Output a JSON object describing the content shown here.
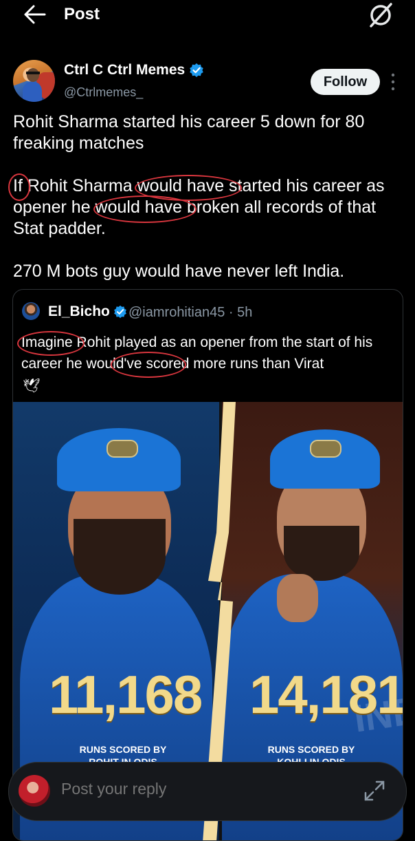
{
  "header": {
    "title": "Post"
  },
  "post": {
    "author_name": "Ctrl C Ctrl Memes",
    "author_handle": "@Ctrlmemes_",
    "follow_label": "Follow",
    "paragraphs": [
      "Rohit Sharma started his career 5 down for 80 freaking matches",
      "If Rohit Sharma would have started his career as opener he would have broken all records of that Stat padder.",
      "270 M bots guy would have never left India."
    ]
  },
  "quote": {
    "author_name": "El_Bicho",
    "author_handle": "@iamrohitian45 · 5h",
    "text": "Imagine Rohit played as an opener from the start of his career he would've scored more runs than Virat",
    "emoji": "🕊",
    "image": {
      "left_stat": "11,168",
      "left_caption": "RUNS SCORED BY",
      "left_caption_cut": "ROHIT IN ODIS",
      "right_stat": "14,181",
      "right_caption": "RUNS SCORED BY",
      "right_caption_cut": "KOHLI IN ODIS",
      "watermark": "INDI"
    }
  },
  "reply": {
    "placeholder": "Post your reply"
  },
  "colors": {
    "accent": "#1d9bf0",
    "annotation": "#d9363e",
    "stat_gold": "#f2d98a"
  },
  "icons": [
    "back-arrow-icon",
    "grok-icon",
    "verified-icon",
    "more-icon",
    "dove-icon",
    "expand-icon"
  ]
}
